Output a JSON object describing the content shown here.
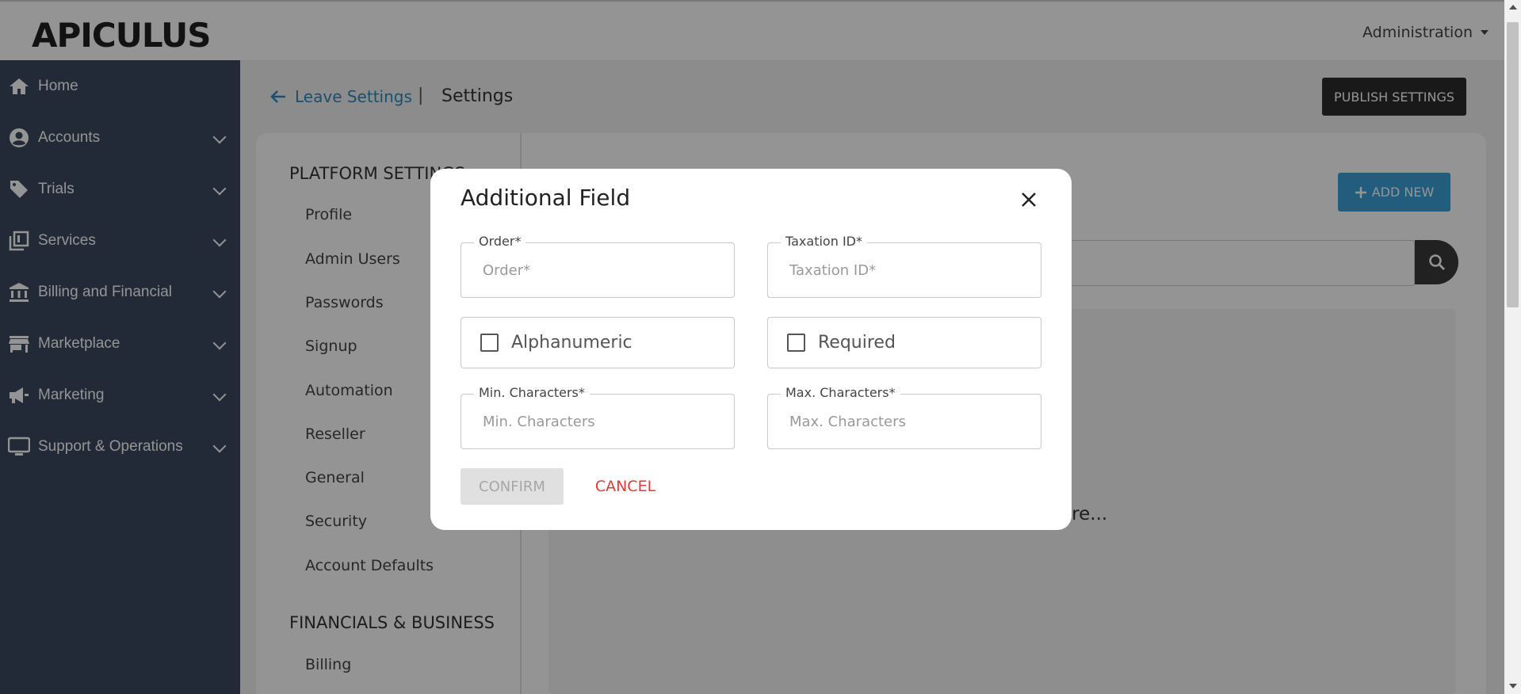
{
  "topbar": {
    "logo": "APICULUS",
    "admin_menu": "Administration"
  },
  "sidebar": {
    "items": [
      {
        "label": "Home",
        "icon": "home-icon"
      },
      {
        "label": "Accounts",
        "icon": "account-circle-icon"
      },
      {
        "label": "Trials",
        "icon": "tag-icon"
      },
      {
        "label": "Services",
        "icon": "library-icon"
      },
      {
        "label": "Billing and Financial",
        "icon": "bank-icon"
      },
      {
        "label": "Marketplace",
        "icon": "store-icon"
      },
      {
        "label": "Marketing",
        "icon": "megaphone-icon"
      },
      {
        "label": "Support & Operations",
        "icon": "monitor-icon"
      }
    ]
  },
  "header": {
    "back_link": "Leave Settings",
    "separator": "|",
    "title": "Settings",
    "publish_button": "PUBLISH SETTINGS"
  },
  "settings_nav": {
    "group1": "PLATFORM SETTINGS",
    "items": [
      "Profile",
      "Admin Users",
      "Passwords",
      "Signup",
      "Automation",
      "Reseller",
      "General",
      "Security",
      "Account Defaults"
    ],
    "group2": "FINANCIALS & BUSINESS",
    "items2": [
      "Billing"
    ]
  },
  "content": {
    "add_new_button": "ADD NEW",
    "hint_fragment": "ere..."
  },
  "modal": {
    "title": "Additional Field",
    "order_label": "Order*",
    "order_placeholder": "Order*",
    "taxation_label": "Taxation ID*",
    "taxation_placeholder": "Taxation ID*",
    "alphanumeric_label": "Alphanumeric",
    "required_label": "Required",
    "min_label": "Min. Characters*",
    "min_placeholder": "Min. Characters",
    "max_label": "Max. Characters*",
    "max_placeholder": "Max. Characters",
    "confirm_button": "CONFIRM",
    "cancel_button": "CANCEL"
  },
  "colors": {
    "sidebar": "#39495d",
    "accent": "#3ba0d8",
    "link": "#2e8bc0",
    "cancel": "#e53935"
  }
}
